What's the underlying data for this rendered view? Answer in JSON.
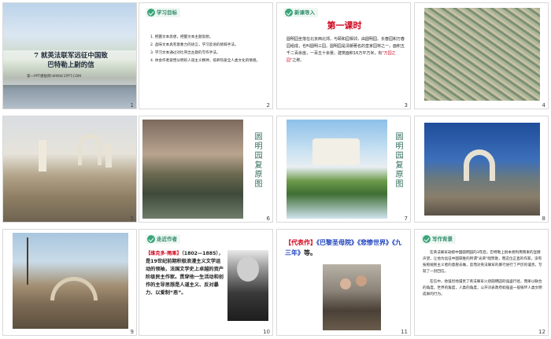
{
  "slides": [
    {
      "num": "1",
      "title_line1": "7 就英法联军远征中国致",
      "title_line2": "巴特勒上尉的信",
      "footer": "第一PPT模板网-WWW.1PPT.COM"
    },
    {
      "num": "2",
      "tag": "学习目标",
      "items": [
        "1. 把握文本思想，把握文本主题思想。",
        "2. 品味文本具有意象力的语言，学习反语的修辞手法。",
        "3. 学习文本通过对比突出主题的写作手法。",
        "4. 体会作者爱憎分明的人道主义精神，培养热爱全人类文化的情感。"
      ]
    },
    {
      "num": "3",
      "tag": "新课导入",
      "title": "第一课时",
      "body_a": "圆明园坐落在北京西北郊，与颐和园相邻，由圆明园、长春园和万春园组成，也叫圆明三园。圆明园是清朝著名的皇家园林之一，面积五千二百余亩，一百五十余景。建筑面积16万平方米，有",
      "body_red": "\"万园之园\"",
      "body_b": "之称。"
    },
    {
      "num": "4"
    },
    {
      "num": "5"
    },
    {
      "num": "6",
      "vtext": "圆明园复原图"
    },
    {
      "num": "7",
      "vtext": "圆明园复原图"
    },
    {
      "num": "8"
    },
    {
      "num": "9"
    },
    {
      "num": "10",
      "tag": "走近作者",
      "name": "【维克多·雨果】",
      "bio_a": "（1802—1885），是19世纪前期积极浪漫主义文学运动的领袖，法国文学史上卓越的资产阶级民主作家。贯穿他一生活动和创作的主导思想是人道主义、反对暴力、以爱制“恶”。"
    },
    {
      "num": "11",
      "works_label": "【代表作】",
      "works_red": "《巴黎圣母院》《悲惨世界》《九三年》",
      "works_tail": "等。"
    },
    {
      "num": "12",
      "tag": "写作背景",
      "para1": "在英法联军劫掠中国圆明园的3年后，巴特勒上尉本想利用雨果的显赫声望，让他为远征中国获胜的所谓\"光荣\"唱赞歌，而这位正直的作家，没有按照殖民主义者的意愿去做，反而对英法联军的暴行进行了严厉的谴责，写就了一封回信。",
      "para2": "在信中，他强烈地谴责了英法联军火烧圆明园的强盗行径，而果以联合的角度，世界的角度，人类的角度，公开对表政府如强盗一般毁坏人类文明成果的行为。"
    }
  ],
  "colors": {
    "accent_green": "#3aa57a",
    "red": "#d0021b"
  }
}
